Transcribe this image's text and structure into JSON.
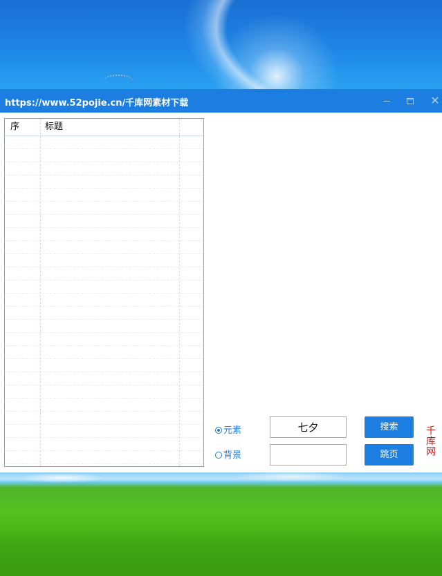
{
  "window": {
    "title": "https://www.52pojie.cn/千库网素材下载"
  },
  "table": {
    "headers": [
      "序",
      "标题"
    ],
    "row_count": 25
  },
  "options": {
    "element_label": "元素",
    "background_label": "背景",
    "selected": "元素"
  },
  "search": {
    "keyword_value": "七夕",
    "page_value": "",
    "search_label": "搜索",
    "jump_label": "跳页"
  },
  "brand_text": "千库网",
  "colors": {
    "accent": "#1b7ee0",
    "brand_red": "#c21a1a"
  }
}
